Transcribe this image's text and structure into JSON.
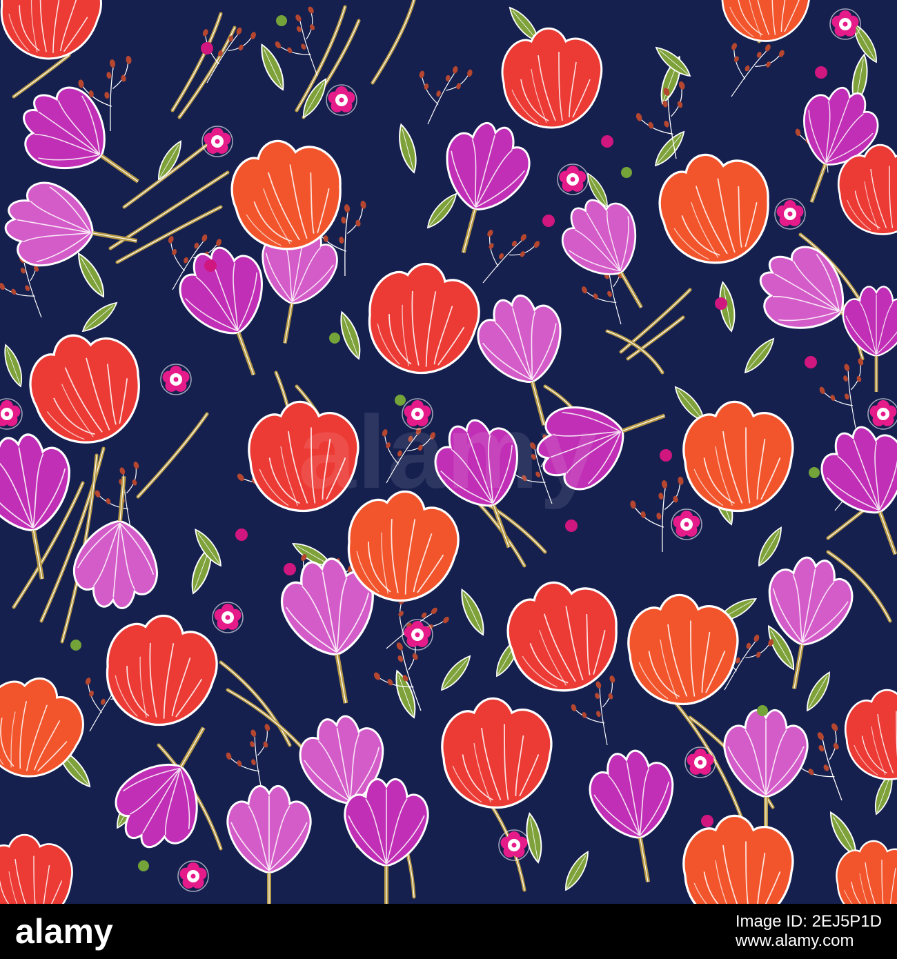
{
  "artwork": {
    "colors": {
      "background": "#16204f",
      "red_tulip": "#ec3a35",
      "orange_tulip": "#f2552c",
      "magenta_crocus": "#c02fb5",
      "violet_crocus": "#d45cc9",
      "leaf_green": "#7ea13a",
      "stem_gold": "#b89a45",
      "outline": "#ffffff",
      "pink_flower": "#e51b8a",
      "magenta_dot": "#d0167f",
      "green_dot": "#74a33a",
      "berry": "#b5462f"
    }
  },
  "watermark": {
    "text": "alamy"
  },
  "footer": {
    "brand": "alamy",
    "image_id": "Image ID: 2EJ5P1D",
    "site": "www.alamy.com"
  }
}
